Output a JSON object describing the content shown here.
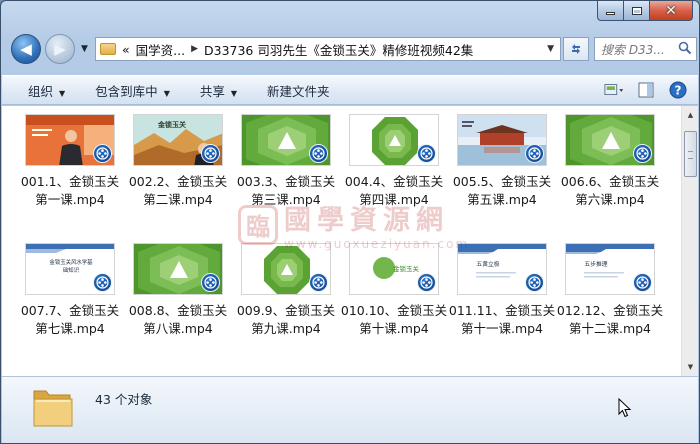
{
  "window": {
    "caption_buttons": {
      "minimize": "minimize",
      "maximize": "maximize",
      "close": "✕"
    }
  },
  "nav": {
    "back_glyph": "◀",
    "forward_glyph": "▶",
    "breadcrumb": [
      "«",
      "国学资...",
      "D33736 司羽先生《金锁玉关》精修班视频42集"
    ],
    "search_placeholder": "搜索 D33...",
    "icons": [
      "back-arrow-icon",
      "forward-arrow-icon",
      "folder-icon",
      "refresh-icon",
      "search-icon"
    ]
  },
  "toolbar": {
    "organize": "组织",
    "include_library": "包含到库中",
    "share": "共享",
    "new_folder": "新建文件夹",
    "icons": [
      "view-options-icon",
      "preview-pane-icon",
      "help-icon"
    ],
    "help_glyph": "?"
  },
  "files": [
    {
      "name": "001.1、金锁玉关第一课.mp4",
      "thumb": "lecture-video-frame"
    },
    {
      "name": "002.2、金锁玉关第二课.mp4",
      "thumb": "landscape-title-frame",
      "thumb_text": "金锁玉关"
    },
    {
      "name": "003.3、金锁玉关第三课.mp4",
      "thumb": "green-triangle-frame"
    },
    {
      "name": "004.4、金锁玉关第四课.mp4",
      "thumb": "green-octagon-frame"
    },
    {
      "name": "005.5、金锁玉关第五课.mp4",
      "thumb": "palace-lake-frame"
    },
    {
      "name": "006.6、金锁玉关第六课.mp4",
      "thumb": "green-triangle-frame"
    },
    {
      "name": "007.7、金锁玉关第七课.mp4",
      "thumb": "slide-title-frame",
      "thumb_text": "金锁玉关风水学基础知识"
    },
    {
      "name": "008.8、金锁玉关第八课.mp4",
      "thumb": "green-triangle-frame"
    },
    {
      "name": "009.9、金锁玉关第九课.mp4",
      "thumb": "green-octagon-frame"
    },
    {
      "name": "010.10、金锁玉关第十课.mp4",
      "thumb": "green-circle-frame",
      "thumb_text": "金锁玉关"
    },
    {
      "name": "011.11、金锁玉关第十一课.mp4",
      "thumb": "slide-blue-frame",
      "thumb_text": "五黄立极"
    },
    {
      "name": "012.12、金锁玉关第十二课.mp4",
      "thumb": "slide-blue-frame",
      "thumb_text": "五步推理"
    }
  ],
  "watermark": {
    "seal": "臨",
    "name": "國學資源網",
    "url": "www.guoxueziyuan.com"
  },
  "status": {
    "count": "43 个对象"
  },
  "colors": {
    "accent": "#2a73c9",
    "green_dark": "#4f9a2e",
    "green_light": "#a9d48a"
  }
}
